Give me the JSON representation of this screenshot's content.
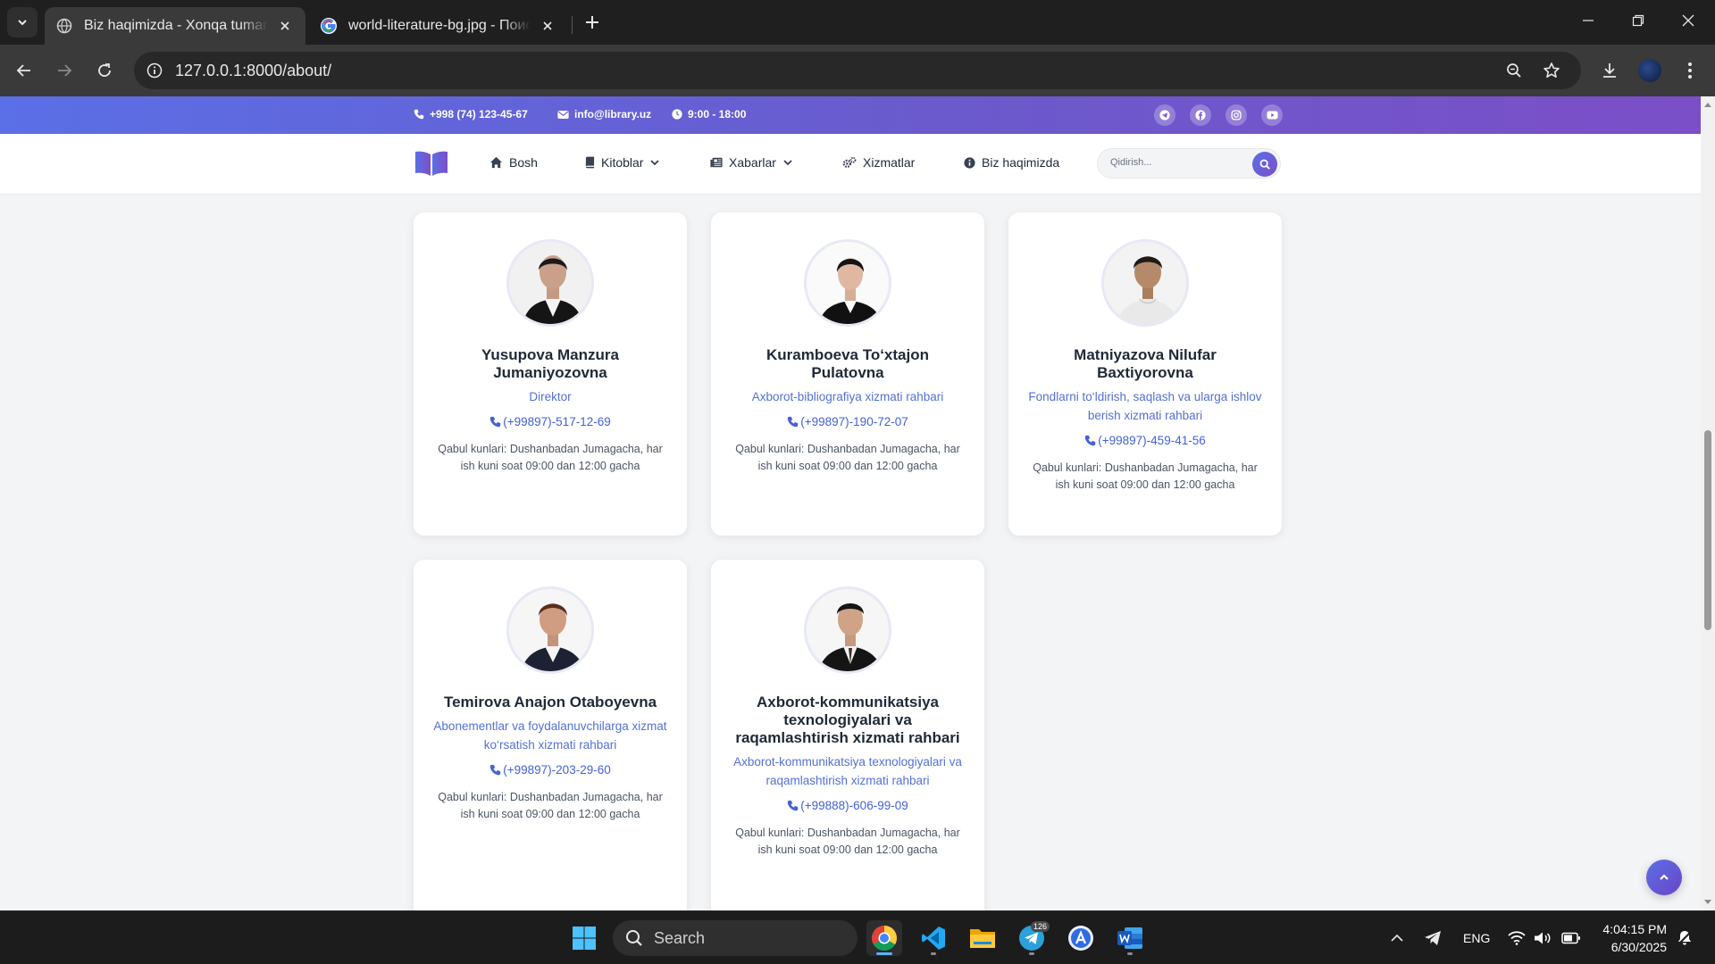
{
  "browser": {
    "tabs": [
      {
        "title": "Biz haqimizda - Xonqa tumani Axborot",
        "active": true
      },
      {
        "title": "world-literature-bg.jpg - Поиск в Google",
        "active": false
      }
    ],
    "url": "127.0.0.1:8000/about/"
  },
  "topbar": {
    "phone": "+998 (74) 123-45-67",
    "email": "info@library.uz",
    "hours": "9:00 - 18:00",
    "socials": [
      "telegram-icon",
      "facebook-icon",
      "instagram-icon",
      "youtube-icon"
    ]
  },
  "nav": {
    "items": [
      {
        "label": "Bosh",
        "icon": "home-icon"
      },
      {
        "label": "Kitoblar",
        "icon": "book-icon",
        "dropdown": true
      },
      {
        "label": "Xabarlar",
        "icon": "newspaper-icon",
        "dropdown": true
      },
      {
        "label": "Xizmatlar",
        "icon": "gears-icon"
      },
      {
        "label": "Biz haqimizda",
        "icon": "info-icon"
      }
    ],
    "search_placeholder": "Qidirish..."
  },
  "staff": [
    {
      "name": "Yusupova Manzura Jumaniyozovna",
      "role": "Direktor",
      "phone": "(+99897)-517-12-69",
      "hours": "Qabul kunlari: Dushanbadan Jumagacha, har ish kuni soat 09:00 dan 12:00 gacha"
    },
    {
      "name": "Kuramboeva To‘xtajon Pulatovna",
      "role": "Axborot-bibliografiya xizmati rahbari",
      "phone": "(+99897)-190-72-07",
      "hours": "Qabul kunlari: Dushanbadan Jumagacha, har ish kuni soat 09:00 dan 12:00 gacha"
    },
    {
      "name": "Matniyazova Nilufar Baxtiyorovna",
      "role": "Fondlarni to‘ldirish, saqlash va ularga ishlov berish xizmati rahbari",
      "phone": "(+99897)-459-41-56",
      "hours": "Qabul kunlari: Dushanbadan Jumagacha, har ish kuni soat 09:00 dan 12:00 gacha"
    },
    {
      "name": "Temirova Anajon Otaboyevna",
      "role": "Abonementlar va foydalanuvchilarga xizmat ko‘rsatish xizmati rahbari",
      "phone": "(+99897)-203-29-60",
      "hours": "Qabul kunlari: Dushanbadan Jumagacha, har ish kuni soat 09:00 dan 12:00 gacha"
    },
    {
      "name": "Axborot-kommunikatsiya texnologiyalari va raqamlashtirish xizmati rahbari",
      "role": "Axborot-kommunikatsiya texnologiyalari va raqamlashtirish xizmati rahbari",
      "phone": "(+99888)-606-99-09",
      "hours": "Qabul kunlari: Dushanbadan Jumagacha, har ish kuni soat 09:00 dan 12:00 gacha"
    }
  ],
  "taskbar": {
    "search_label": "Search",
    "telegram_badge": "126",
    "language": "ENG",
    "time": "4:04:15 PM",
    "date": "6/30/2025"
  },
  "colors": {
    "accent": "#5b6fe6",
    "accent2": "#7b4fc8",
    "link": "#4361d8"
  }
}
